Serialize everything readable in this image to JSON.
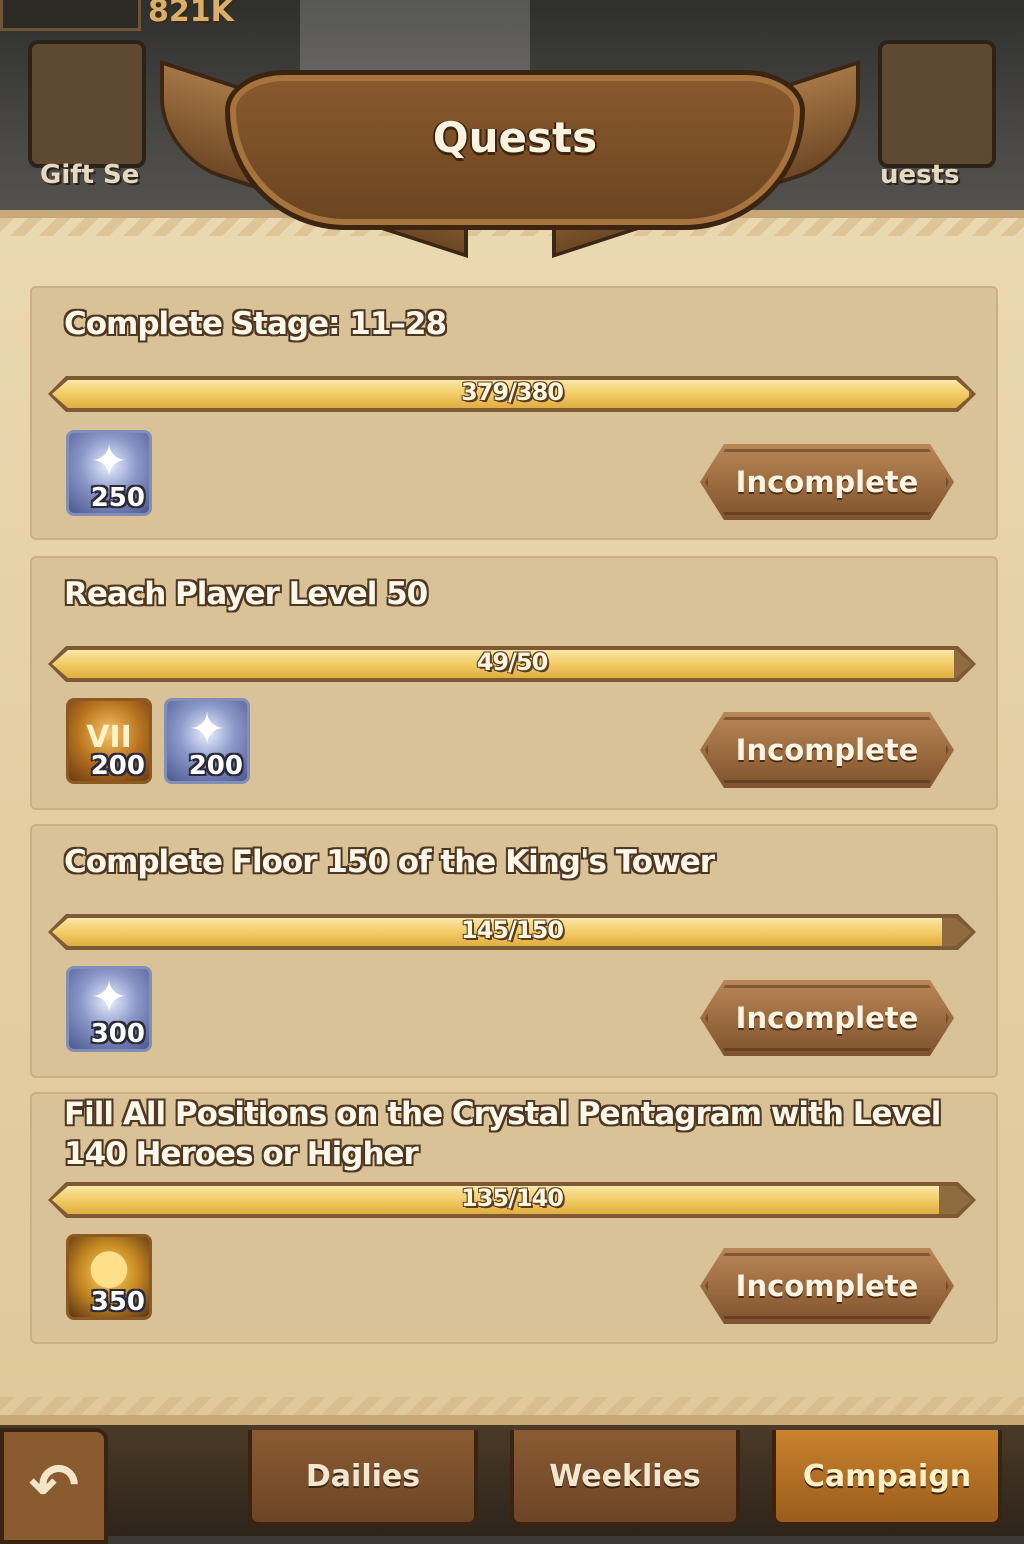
{
  "header": {
    "power": "821K",
    "left_button_label": "Gift Se",
    "right_button_label": "uests",
    "title": "Quests"
  },
  "quests": [
    {
      "title": "Complete Stage: 11–28",
      "progress_text": "379/380",
      "progress": 0.997,
      "rewards": [
        {
          "icon": "diamond-icon",
          "count": "250"
        }
      ],
      "status": "Incomplete"
    },
    {
      "title": "Reach Player Level 50",
      "progress_text": "49/50",
      "progress": 0.98,
      "rewards": [
        {
          "icon": "medal-icon",
          "glyph": "VII",
          "count": "200"
        },
        {
          "icon": "diamond-icon",
          "count": "200"
        }
      ],
      "status": "Incomplete"
    },
    {
      "title": "Complete Floor 150 of the King's Tower",
      "progress_text": "145/150",
      "progress": 0.967,
      "rewards": [
        {
          "icon": "diamond-icon",
          "count": "300"
        }
      ],
      "status": "Incomplete"
    },
    {
      "title": "Fill All Positions on the Crystal Pentagram with Level 140 Heroes or Higher",
      "progress_text": "135/140",
      "progress": 0.964,
      "rewards": [
        {
          "icon": "gold-coin-icon",
          "count": "350"
        }
      ],
      "status": "Incomplete"
    }
  ],
  "tabs": [
    {
      "label": "Dailies"
    },
    {
      "label": "Weeklies"
    },
    {
      "label": "Campaign",
      "active": true
    }
  ],
  "colors": {
    "parchment": "#e4cfa3",
    "progress_fill": "#f2cc66",
    "button_brown": "#9a6a3f",
    "active_tab": "#c9822e"
  }
}
